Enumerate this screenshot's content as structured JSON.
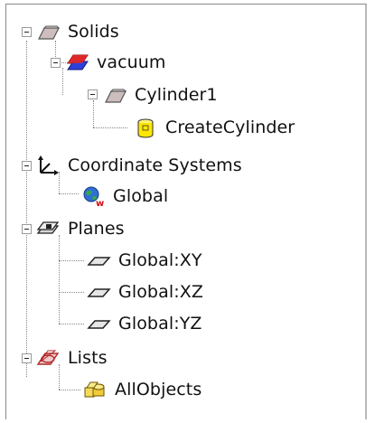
{
  "tree": {
    "solids": {
      "label": "Solids",
      "icon": "solid-icon"
    },
    "vacuum": {
      "label": "vacuum",
      "icon": "material-icon"
    },
    "cylinder1": {
      "label": "Cylinder1",
      "icon": "solid-icon"
    },
    "create_cylinder": {
      "label": "CreateCylinder",
      "icon": "cylinder-icon"
    },
    "coordinate_systems": {
      "label": "Coordinate Systems",
      "icon": "axes-icon"
    },
    "global_cs": {
      "label": "Global",
      "icon": "globe-icon"
    },
    "planes": {
      "label": "Planes",
      "icon": "planes-icon"
    },
    "plane_xy": {
      "label": "Global:XY",
      "icon": "plane-icon"
    },
    "plane_xz": {
      "label": "Global:XZ",
      "icon": "plane-icon"
    },
    "plane_yz": {
      "label": "Global:YZ",
      "icon": "plane-icon"
    },
    "lists": {
      "label": "Lists",
      "icon": "list-icon"
    },
    "all_objects": {
      "label": "AllObjects",
      "icon": "objects-icon"
    }
  },
  "colors": {
    "expander_border": "#9a9a9a",
    "tree_lines": "#888888",
    "solid_icon": "#b9a9a9",
    "material_blue": "#2d3fd8",
    "material_red": "#e02828",
    "cylinder_yellow": "#ffe600",
    "list_red": "#c0392b"
  }
}
